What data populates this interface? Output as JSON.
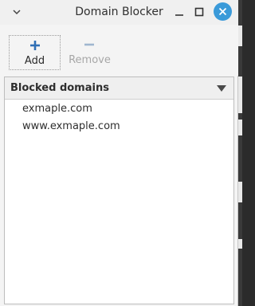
{
  "window": {
    "title": "Domain Blocker",
    "accent": "#3a9ad9"
  },
  "toolbar": {
    "add_label": "Add",
    "remove_label": "Remove"
  },
  "list": {
    "header": "Blocked domains",
    "items": [
      "exmaple.com",
      "www.exmaple.com"
    ]
  }
}
